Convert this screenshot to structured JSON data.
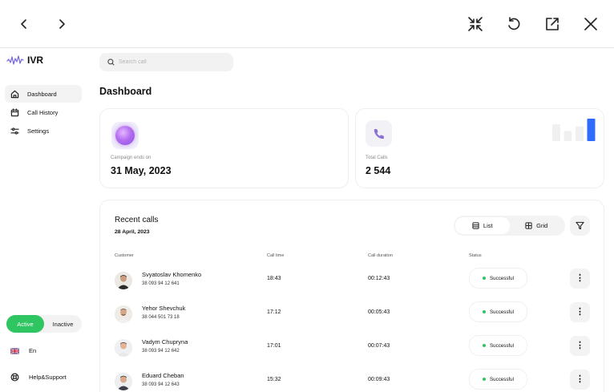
{
  "viewer": {
    "icons": [
      "chevron-left-icon",
      "chevron-right-icon",
      "collapse-icon",
      "undo-icon",
      "external-link-icon",
      "close-icon"
    ]
  },
  "app": {
    "name": "IVR",
    "accent": "#2fc561",
    "brand": "#7a6bdc"
  },
  "sidebar": {
    "items": [
      {
        "label": "Dashboard",
        "icon": "home-icon",
        "selected": true
      },
      {
        "label": "Call History",
        "icon": "calendar-icon",
        "selected": false
      },
      {
        "label": "Settings",
        "icon": "sliders-icon",
        "selected": false
      }
    ],
    "toggle": {
      "active": "Active",
      "inactive": "Inactive",
      "selected": "Active"
    },
    "language": "En",
    "support": "Help&Support"
  },
  "search": {
    "placeholder": "Search call",
    "value": ""
  },
  "dashboard": {
    "title": "Dashboard",
    "campaign": {
      "label": "Campaign ends on",
      "value": "31 May, 2023"
    },
    "total_calls": {
      "label": "Total Calls",
      "value": "2 544",
      "bar_levels": [
        0.75,
        0.45,
        0.65,
        1.0
      ]
    }
  },
  "recent": {
    "title": "Recent calls",
    "date": "28 April, 2023",
    "view": {
      "list": "List",
      "grid": "Grid",
      "selected": "List"
    },
    "columns": {
      "customer": "Customer",
      "call_time": "Call time",
      "duration": "Call duration",
      "status": "Status"
    },
    "rows": [
      {
        "name": "Svyatoslav Khomenko",
        "phone": "38 093 94 12 641",
        "time": "18:43",
        "duration": "00:12:43",
        "status": "Successful"
      },
      {
        "name": "Yehor Shevchuk",
        "phone": "38 044 501 73 18",
        "time": "17:12",
        "duration": "00:05:43",
        "status": "Successful"
      },
      {
        "name": "Vadym Chupryna",
        "phone": "38 093 94 12 642",
        "time": "17:01",
        "duration": "00:07:43",
        "status": "Successful"
      },
      {
        "name": "Eduard Cheban",
        "phone": "38 093 94 12 643",
        "time": "15:32",
        "duration": "00:09:43",
        "status": "Successful"
      }
    ]
  }
}
